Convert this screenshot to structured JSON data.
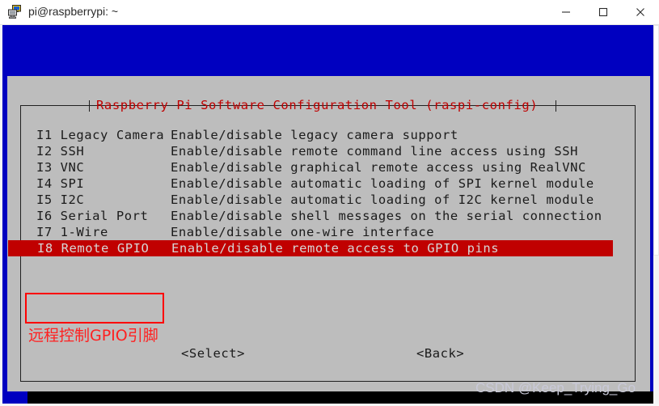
{
  "window": {
    "title": "pi@raspberrypi: ~",
    "icon": "putty-terminal-icon",
    "controls": {
      "minimize": "minimize-icon",
      "maximize": "maximize-icon",
      "close": "close-icon"
    }
  },
  "dialog": {
    "title": "Raspberry Pi Software Configuration Tool (raspi-config)",
    "title_color": "#c00000",
    "background_color": "#bdbdbd",
    "items": [
      {
        "code": "I1 Legacy Camera",
        "desc": "Enable/disable legacy camera support",
        "selected": false
      },
      {
        "code": "I2 SSH",
        "desc": "Enable/disable remote command line access using SSH",
        "selected": false
      },
      {
        "code": "I3 VNC",
        "desc": "Enable/disable graphical remote access using RealVNC",
        "selected": false
      },
      {
        "code": "I4 SPI",
        "desc": "Enable/disable automatic loading of SPI kernel module",
        "selected": false
      },
      {
        "code": "I5 I2C",
        "desc": "Enable/disable automatic loading of I2C kernel module",
        "selected": false
      },
      {
        "code": "I6 Serial Port",
        "desc": "Enable/disable shell messages on the serial connection",
        "selected": false
      },
      {
        "code": "I7 1-Wire",
        "desc": "Enable/disable one-wire interface",
        "selected": false
      },
      {
        "code": "I8 Remote GPIO",
        "desc": "Enable/disable remote access to GPIO pins",
        "selected": true
      }
    ],
    "buttons": {
      "select": "<Select>",
      "back": "<Back>"
    },
    "selection_color": "#c00000"
  },
  "annotation": {
    "text": "远程控制GPIO引脚",
    "color": "#ff0000"
  },
  "watermark": {
    "text": "CSDN @Keep_Trying_Go"
  },
  "terminal": {
    "background_color": "#0000c0"
  }
}
